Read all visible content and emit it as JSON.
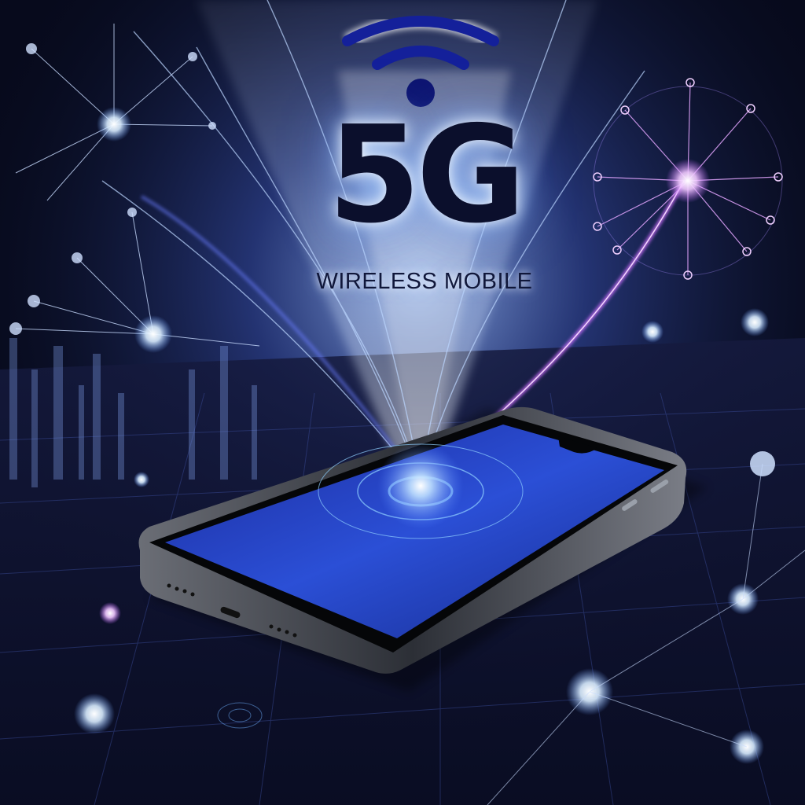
{
  "headline": "5G",
  "subline": "WIRELESS MOBILE",
  "icons": {
    "signal": "wifi-signal-icon",
    "device": "smartphone-icon"
  },
  "colors": {
    "background": "#070a1c",
    "beam_blue": "#7fb0ff",
    "beam_violet": "#c768ff",
    "screen_blue": "#2540c8",
    "text_dark": "#0b0f2c"
  }
}
